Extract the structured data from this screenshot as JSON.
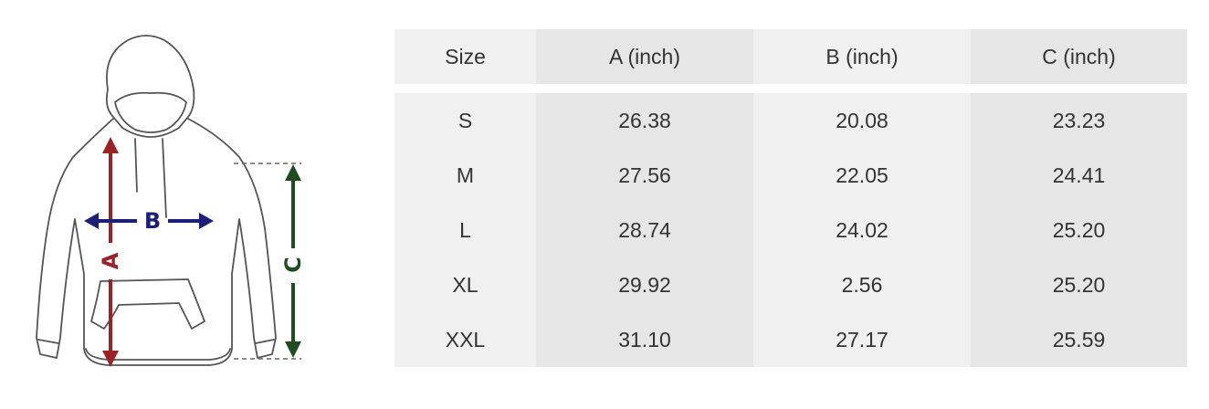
{
  "diagram": {
    "garment": "hoodie",
    "labels": {
      "a": "A",
      "b": "B",
      "c": "C"
    },
    "colors": {
      "a": "#9b2226",
      "b": "#1b1f7a",
      "c": "#1f4d1f",
      "outline": "#555555"
    }
  },
  "table": {
    "headers": [
      "Size",
      "A (inch)",
      "B (inch)",
      "C (inch)"
    ],
    "rows": [
      [
        "S",
        "26.38",
        "20.08",
        "23.23"
      ],
      [
        "M",
        "27.56",
        "22.05",
        "24.41"
      ],
      [
        "L",
        "28.74",
        "24.02",
        "25.20"
      ],
      [
        "XL",
        "29.92",
        "2.56",
        "25.20"
      ],
      [
        "XXL",
        "31.10",
        "27.17",
        "25.59"
      ]
    ]
  }
}
